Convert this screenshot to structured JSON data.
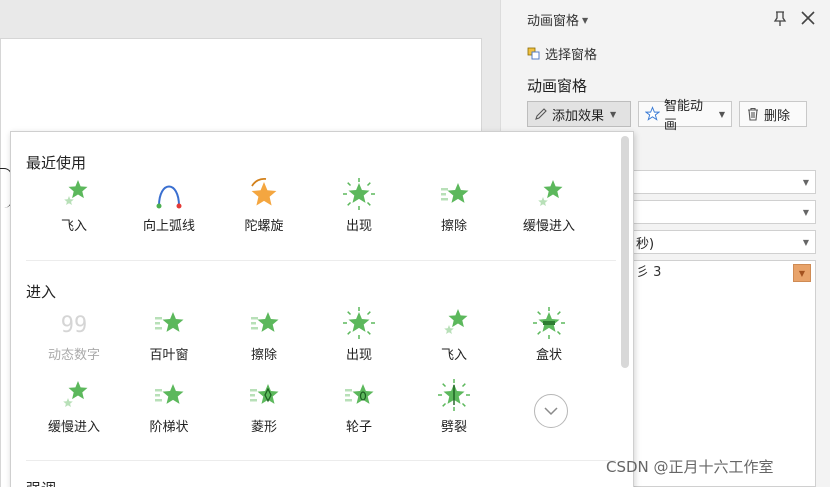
{
  "pane": {
    "header": "动画窗格",
    "select_pane": "选择窗格",
    "title": "动画窗格",
    "add_effect": "添加效果",
    "smart_animation": "智能动画",
    "delete": "删除",
    "duration_partial": "秒)",
    "list_item_partial": "彡 3",
    "accent_color": "#e8a36a"
  },
  "dropdown": {
    "recent_title": "最近使用",
    "recent": [
      {
        "label": "飞入",
        "icon": "fly-in-icon"
      },
      {
        "label": "向上弧线",
        "icon": "arc-up-icon"
      },
      {
        "label": "陀螺旋",
        "icon": "spin-icon"
      },
      {
        "label": "出现",
        "icon": "appear-icon"
      },
      {
        "label": "擦除",
        "icon": "wipe-icon"
      },
      {
        "label": "缓慢进入",
        "icon": "crawl-in-icon"
      }
    ],
    "entrance_title": "进入",
    "entrance": [
      {
        "label": "动态数字",
        "icon": "dynamic-number-icon",
        "disabled": true
      },
      {
        "label": "百叶窗",
        "icon": "blinds-icon"
      },
      {
        "label": "擦除",
        "icon": "wipe-icon"
      },
      {
        "label": "出现",
        "icon": "appear-icon"
      },
      {
        "label": "飞入",
        "icon": "fly-in-icon"
      },
      {
        "label": "盒状",
        "icon": "box-icon"
      },
      {
        "label": "缓慢进入",
        "icon": "crawl-in-icon"
      },
      {
        "label": "阶梯状",
        "icon": "stairs-icon"
      },
      {
        "label": "菱形",
        "icon": "diamond-icon"
      },
      {
        "label": "轮子",
        "icon": "wheel-icon"
      },
      {
        "label": "劈裂",
        "icon": "split-icon"
      }
    ],
    "emphasis_title_partial": "强调"
  },
  "watermark": "CSDN @正月十六工作室",
  "colors": {
    "star": "#5cb85c",
    "star_light": "#b8e0b8",
    "star_orange": "#f4a640"
  }
}
